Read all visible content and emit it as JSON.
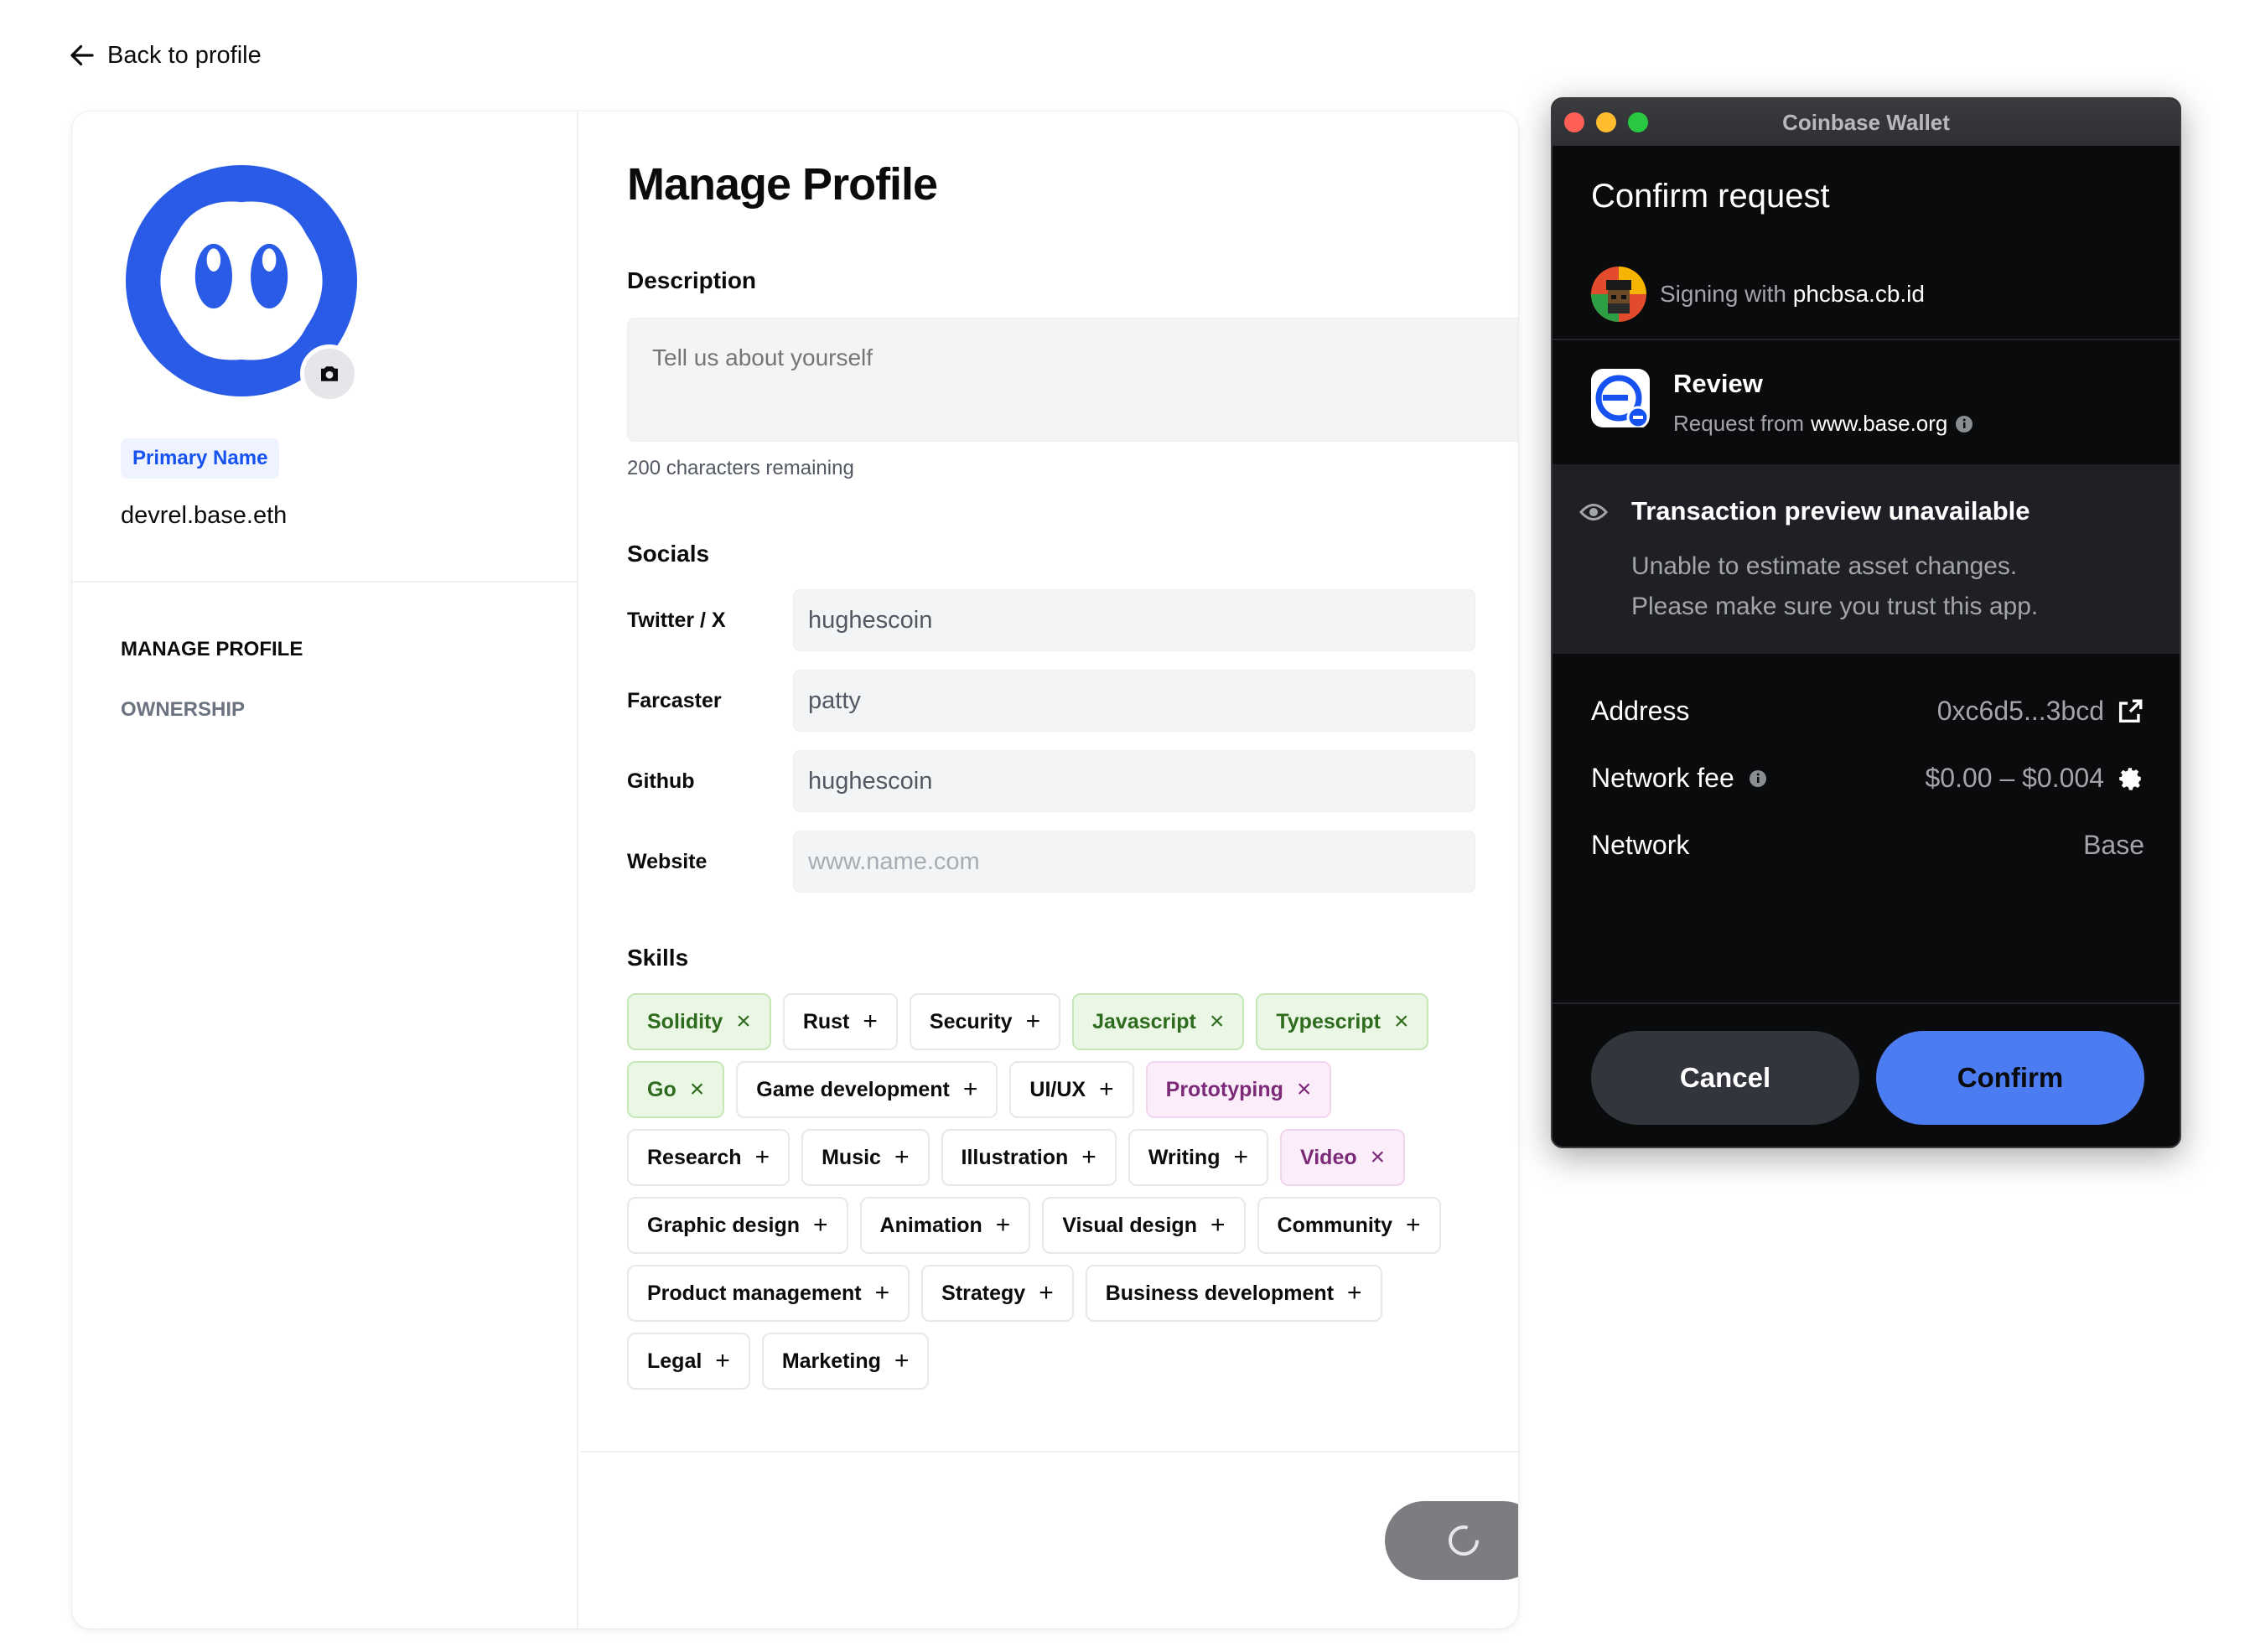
{
  "back": {
    "label": "Back to profile"
  },
  "sidebar": {
    "primary_badge": "Primary Name",
    "handle": "devrel.base.eth",
    "nav": [
      "MANAGE PROFILE",
      "OWNERSHIP"
    ]
  },
  "main": {
    "title": "Manage Profile",
    "description_label": "Description",
    "description_placeholder": "Tell us about yourself",
    "chars_remaining": "200 characters remaining",
    "socials_label": "Socials",
    "socials": [
      {
        "name": "Twitter / X",
        "value": "hughescoin",
        "placeholder": false
      },
      {
        "name": "Farcaster",
        "value": "patty",
        "placeholder": false
      },
      {
        "name": "Github",
        "value": "hughescoin",
        "placeholder": false
      },
      {
        "name": "Website",
        "value": "www.name.com",
        "placeholder": true
      }
    ],
    "skills_label": "Skills",
    "skills_rows": [
      [
        {
          "label": "Solidity",
          "state": "green"
        },
        {
          "label": "Rust",
          "state": "none"
        },
        {
          "label": "Security",
          "state": "none"
        },
        {
          "label": "Javascript",
          "state": "green"
        },
        {
          "label": "Typescript",
          "state": "green"
        }
      ],
      [
        {
          "label": "Go",
          "state": "green"
        },
        {
          "label": "Game development",
          "state": "none"
        },
        {
          "label": "UI/UX",
          "state": "none"
        },
        {
          "label": "Prototyping",
          "state": "purple"
        }
      ],
      [
        {
          "label": "Research",
          "state": "none"
        },
        {
          "label": "Music",
          "state": "none"
        },
        {
          "label": "Illustration",
          "state": "none"
        },
        {
          "label": "Writing",
          "state": "none"
        },
        {
          "label": "Video",
          "state": "purple"
        }
      ],
      [
        {
          "label": "Graphic design",
          "state": "none"
        },
        {
          "label": "Animation",
          "state": "none"
        },
        {
          "label": "Visual design",
          "state": "none"
        },
        {
          "label": "Community",
          "state": "none"
        }
      ],
      [
        {
          "label": "Product management",
          "state": "none"
        },
        {
          "label": "Strategy",
          "state": "none"
        },
        {
          "label": "Business development",
          "state": "none"
        }
      ],
      [
        {
          "label": "Legal",
          "state": "none"
        },
        {
          "label": "Marketing",
          "state": "none"
        }
      ]
    ]
  },
  "wallet": {
    "window_title": "Coinbase Wallet",
    "title": "Confirm request",
    "signing_prefix": "Signing with",
    "signing_id": "phcbsa.cb.id",
    "review_title": "Review",
    "review_prefix": "Request from",
    "review_domain": "www.base.org",
    "preview_title": "Transaction preview unavailable",
    "preview_line1": "Unable to estimate asset changes.",
    "preview_line2": "Please make sure you trust this app.",
    "address_label": "Address",
    "address_value": "0xc6d5...3bcd",
    "fee_label": "Network fee",
    "fee_value": "$0.00 – $0.004",
    "network_label": "Network",
    "network_value": "Base",
    "cancel": "Cancel",
    "confirm": "Confirm"
  },
  "colors": {
    "brand_blue": "#1652f0",
    "confirm_blue": "#4c7cf1",
    "skill_green": "#e9f7e4",
    "skill_purple": "#fbeefa"
  }
}
